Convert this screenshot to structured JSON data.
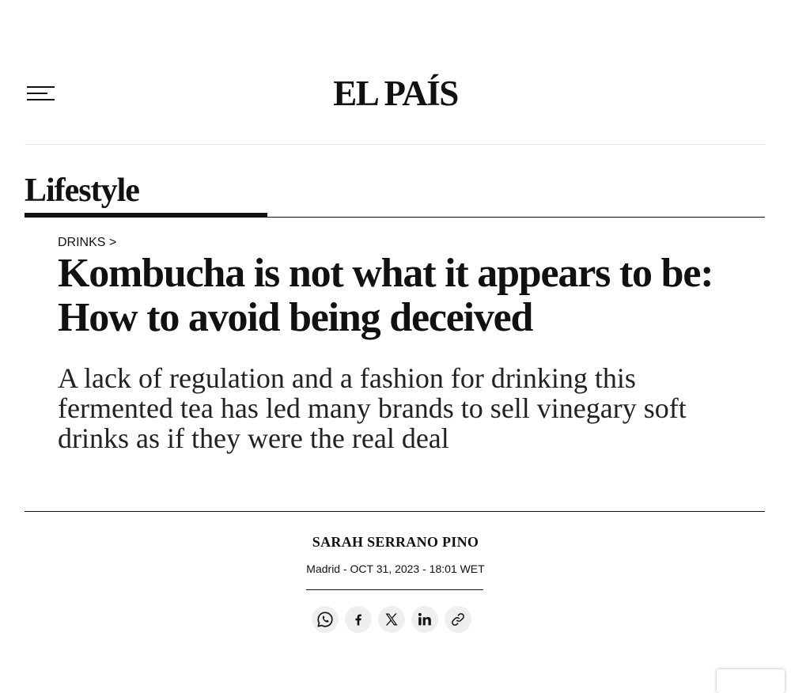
{
  "header": {
    "logo_text": "EL PAÍS",
    "menu_icon": "hamburger-menu-icon"
  },
  "section": {
    "title": "Lifestyle"
  },
  "article": {
    "kicker": "DRINKS >",
    "headline": "Kombucha is not what it appears to be: How to avoid being deceived",
    "standfirst": "A lack of regulation and a fashion for drinking this fermented tea has led many brands to sell vinegary soft drinks as if they were the real deal",
    "author": "SARAH SERRANO PINO",
    "dateline": "Madrid - OCT 31, 2023 - 18:01 WET"
  },
  "share": {
    "icons": [
      "whatsapp-icon",
      "facebook-icon",
      "x-icon",
      "linkedin-icon",
      "link-icon"
    ]
  },
  "colors": {
    "text": "#111111",
    "rule_light": "#e6e6e6",
    "share_bg": "#efefef",
    "logo_accent": "#2a4a7a"
  }
}
